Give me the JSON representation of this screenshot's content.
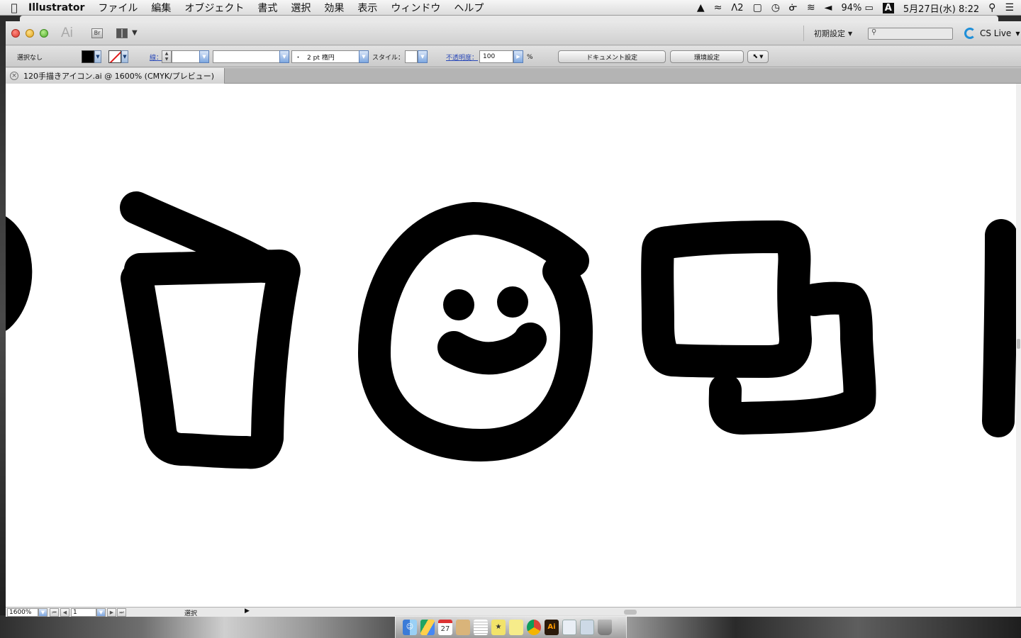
{
  "menubar": {
    "apple": "",
    "app_name": "Illustrator",
    "items": [
      "ファイル",
      "編集",
      "オブジェクト",
      "書式",
      "選択",
      "効果",
      "表示",
      "ウィンドウ",
      "ヘルプ"
    ],
    "status": {
      "adobe_count": "2",
      "battery": "94%",
      "input_mode": "A",
      "date": "5月27日(水)",
      "time": "8:22"
    }
  },
  "appbar": {
    "logo": "Ai",
    "bridge": "Br",
    "workspace": "初期設定",
    "search_placeholder": "",
    "cs_live": "CS Live"
  },
  "controlbar": {
    "selection": "選択なし",
    "fill_color": "#000000",
    "stroke_label": "線",
    "stroke_weight": "",
    "profile": "",
    "brush": "2 pt 楕円",
    "brush_prefix": "・",
    "style_label": "スタイル：",
    "opacity_label": "不透明度",
    "opacity_value": "100",
    "opacity_unit": "%",
    "doc_setup": "ドキュメント設定",
    "prefs": "環境設定"
  },
  "document": {
    "tab_title": "120手描きアイコン.ai @ 1600% (CMYK/プレビュー)"
  },
  "canvas": {
    "icons": [
      "partial-circle",
      "cup-with-straw",
      "smiley-face",
      "overlapping-squares",
      "partial-vertical-bar"
    ],
    "stroke_color": "#000000"
  },
  "statusbar": {
    "zoom": "1600%",
    "page": "1",
    "status_text": "選択"
  },
  "dock": {
    "apps": [
      "Finder",
      "Google Drive",
      "Calendar",
      "Notebook",
      "Spreadsheet",
      "Stickies",
      "Notes",
      "Chrome",
      "Illustrator",
      "Documents",
      "Preview",
      "Trash"
    ]
  }
}
